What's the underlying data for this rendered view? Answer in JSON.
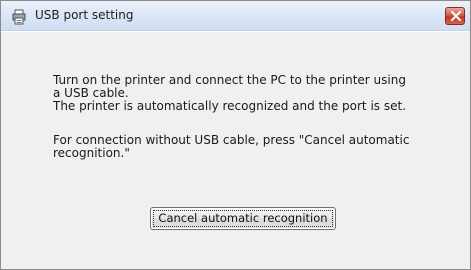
{
  "window": {
    "title": "USB port setting",
    "app_icon": "printer-icon",
    "close_icon": "close-icon"
  },
  "dialog": {
    "message_lines": [
      "Turn on the printer and connect the PC to the printer using",
      "a USB cable.",
      "The printer is automatically recognized and the port is set."
    ],
    "note_lines": [
      "For connection without USB cable, press \"Cancel automatic",
      "recognition.\""
    ],
    "cancel_button_label": "Cancel automatic recognition"
  },
  "colors": {
    "close_button": "#c2371f",
    "titlebar": "#dce8f7",
    "client_background": "#f0f0f0"
  }
}
